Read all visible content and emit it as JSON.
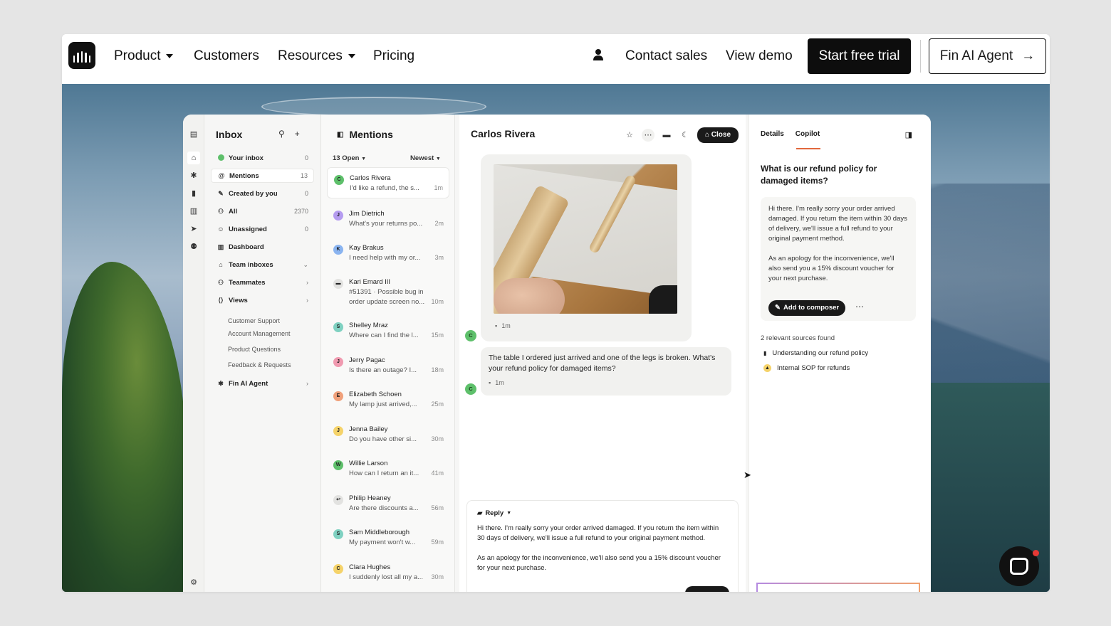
{
  "nav": {
    "items": [
      {
        "label": "Product",
        "dropdown": true
      },
      {
        "label": "Customers",
        "dropdown": false
      },
      {
        "label": "Resources",
        "dropdown": true
      },
      {
        "label": "Pricing",
        "dropdown": false
      }
    ],
    "contact_sales": "Contact sales",
    "view_demo": "View demo",
    "start_trial": "Start free trial",
    "fin_agent": "Fin AI Agent",
    "arrow": "→"
  },
  "inbox": {
    "title": "Inbox",
    "items": [
      {
        "label": "Your inbox",
        "count": "0",
        "icon": "inbox-dot-icon"
      },
      {
        "label": "Mentions",
        "count": "13",
        "icon": "at-icon",
        "selected": true
      },
      {
        "label": "Created by you",
        "count": "0",
        "icon": "pencil-icon"
      },
      {
        "label": "All",
        "count": "2370",
        "icon": "people-icon"
      },
      {
        "label": "Unassigned",
        "count": "0",
        "icon": "unassigned-icon"
      },
      {
        "label": "Dashboard",
        "count": "",
        "icon": "chart-icon"
      },
      {
        "label": "Team inboxes",
        "count": "",
        "icon": "tray-icon",
        "chevron": "⌄"
      },
      {
        "label": "Teammates",
        "count": "",
        "icon": "people-icon",
        "chevron": "›"
      },
      {
        "label": "Views",
        "count": "",
        "icon": "views-icon",
        "chevron": "›"
      }
    ],
    "views": [
      "Customer Support",
      "Account Management",
      "Product Questions",
      "Feedback & Requests"
    ],
    "fin": "Fin AI Agent"
  },
  "mentions": {
    "title": "Mentions",
    "filter_open": "13 Open",
    "filter_sort": "Newest",
    "conversations": [
      {
        "initial": "C",
        "name": "Carlos Rivera",
        "preview": "I'd like a refund, the s...",
        "time": "1m",
        "color": "#5ec06b"
      },
      {
        "initial": "J",
        "name": "Jim Dietrich",
        "preview": "What's your returns po...",
        "time": "2m",
        "color": "#b59cf0"
      },
      {
        "initial": "K",
        "name": "Kay Brakus",
        "preview": "I need help with my or...",
        "time": "3m",
        "color": "#8ab4f0"
      },
      {
        "initial": "",
        "name": "Kari Emard III",
        "preview": "#51391 · Possible bug in",
        "preview2": "order update screen no...",
        "time": "10m",
        "color": "#e2e2e0"
      },
      {
        "initial": "S",
        "name": "Shelley Mraz",
        "preview": "Where can I find the l...",
        "time": "15m",
        "color": "#7fd1c1"
      },
      {
        "initial": "J",
        "name": "Jerry Pagac",
        "preview": "Is there an outage? I...",
        "time": "18m",
        "color": "#f09ab0"
      },
      {
        "initial": "E",
        "name": "Elizabeth Schoen",
        "preview": "My lamp just arrived,...",
        "time": "25m",
        "color": "#f0a07a"
      },
      {
        "initial": "J",
        "name": "Jenna Bailey",
        "preview": "Do you have other si...",
        "time": "30m",
        "color": "#f5d36a"
      },
      {
        "initial": "W",
        "name": "Willie Larson",
        "preview": "How can I return an it...",
        "time": "41m",
        "color": "#5ec06b"
      },
      {
        "initial": "",
        "name": "Philip Heaney",
        "preview": "Are there discounts a...",
        "time": "56m",
        "color": "#e2e2e0"
      },
      {
        "initial": "S",
        "name": "Sam Middleborough",
        "preview": "My payment won't w...",
        "time": "59m",
        "color": "#7fd1c1"
      },
      {
        "initial": "C",
        "name": "Clara Hughes",
        "preview": "I suddenly lost all my a...",
        "time": "30m",
        "color": "#f5d36a"
      }
    ]
  },
  "chat": {
    "customer": "Carlos Rivera",
    "close": "Close",
    "avatar_initial": "C",
    "image_time": "1m",
    "message": "The table I ordered just arrived and one of the legs is broken. What's your refund policy for damaged items?",
    "message_time": "1m",
    "reply_label": "Reply",
    "composer_p1": "Hi there. I'm really sorry your order arrived damaged. If you return the item within 30 days of delivery, we'll issue a full refund to your original payment method.",
    "composer_p2": "As an apology for the inconvenience, we'll also send you a 15% discount voucher for your next purchase."
  },
  "copilot": {
    "tab_details": "Details",
    "tab_copilot": "Copilot",
    "question": "What is our refund policy for damaged items?",
    "answer_p1": "Hi there. I'm really sorry your order arrived damaged. If you return the item within 30 days of delivery, we'll issue a full refund to your original payment method.",
    "answer_p2": "As an apology for the inconvenience, we'll also send you a 15% discount voucher for your next purchase.",
    "add_to_composer": "Add to composer",
    "sources_header": "2 relevant sources found",
    "sources": [
      "Understanding our refund policy",
      "Internal SOP for refunds"
    ]
  },
  "colors": {
    "accent": "#e2683c",
    "dark": "#0d0d0d",
    "avatar_green": "#5ec06b"
  }
}
